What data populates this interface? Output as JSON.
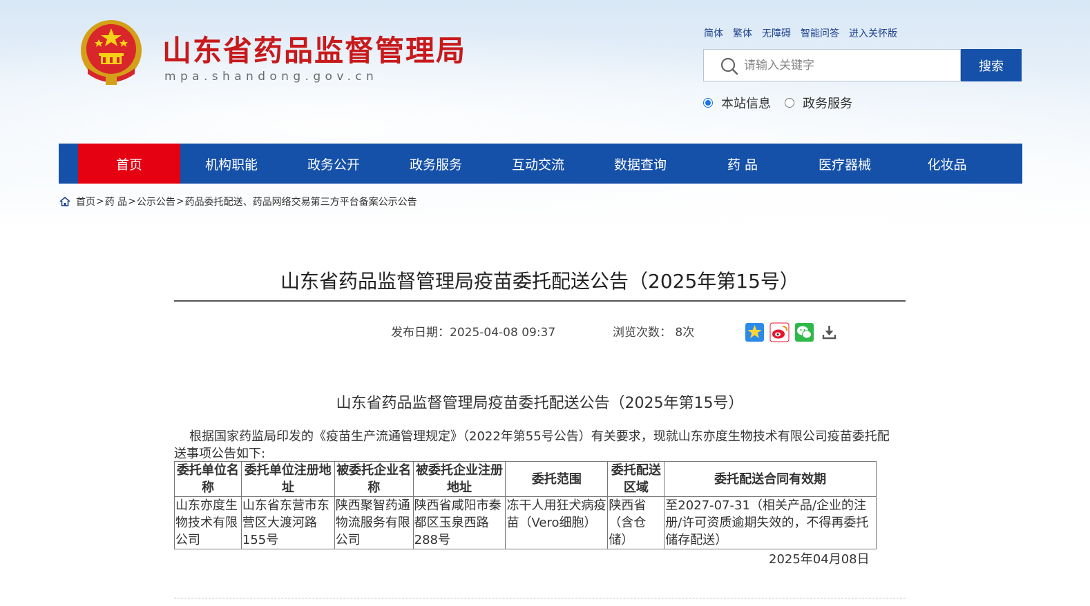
{
  "header": {
    "site_title": "山东省药品监督管理局",
    "site_domain": "mpa.shandong.gov.cn",
    "top_links": [
      "简体",
      "繁体",
      "无障碍",
      "智能问答",
      "进入关怀版"
    ],
    "search": {
      "placeholder": "请输入关键字",
      "button_label": "搜索"
    },
    "scope_options": [
      {
        "label": "本站信息",
        "checked": true
      },
      {
        "label": "政务服务",
        "checked": false
      }
    ]
  },
  "nav": {
    "items": [
      "首页",
      "机构职能",
      "政务公开",
      "政务服务",
      "互动交流",
      "数据查询",
      "药 品",
      "医疗器械",
      "化妆品"
    ],
    "active_index": 0,
    "colors": {
      "bar": "#1550a9",
      "active": "#e50012"
    }
  },
  "breadcrumb": {
    "items": [
      "首页",
      "药 品",
      "公示公告",
      "药品委托配送、药品网络交易第三方平台备案公示公告"
    ],
    "separator": ">"
  },
  "article": {
    "title": "山东省药品监督管理局疫苗委托配送公告（2025年第15号）",
    "publish_date": "发布日期：2025-04-08 09:37",
    "views": "浏览次数：  8次",
    "share_icons": [
      "favorite-icon",
      "weibo-icon",
      "wechat-icon",
      "download-icon"
    ],
    "body_title": "山东省药品监督管理局疫苗委托配送公告（2025年第15号）",
    "body_paragraph": "根据国家药监局印发的《疫苗生产流通管理规定》（2022年第55号公告）有关要求，现就山东亦度生物技术有限公司疫苗委托配送事项公告如下:",
    "table": {
      "headers": [
        "委托单位名称",
        "委托单位注册地址",
        "被委托企业名称",
        "被委托企业注册地址",
        "委托范围",
        "委托配送区域",
        "委托配送合同有效期"
      ],
      "rows": [
        [
          "山东亦度生物技术有限公司",
          "山东省东营市东营区大渡河路155号",
          "陕西聚智药通物流服务有限公司",
          "陕西省咸阳市秦都区玉泉西路288号",
          "冻干人用狂犬病疫苗（Vero细胞）",
          "陕西省（含仓储）",
          "至2027-07-31（相关产品/企业的注册/许可资质逾期失效的，不得再委托储存配送）"
        ]
      ]
    },
    "sign_date": "2025年04月08日"
  }
}
